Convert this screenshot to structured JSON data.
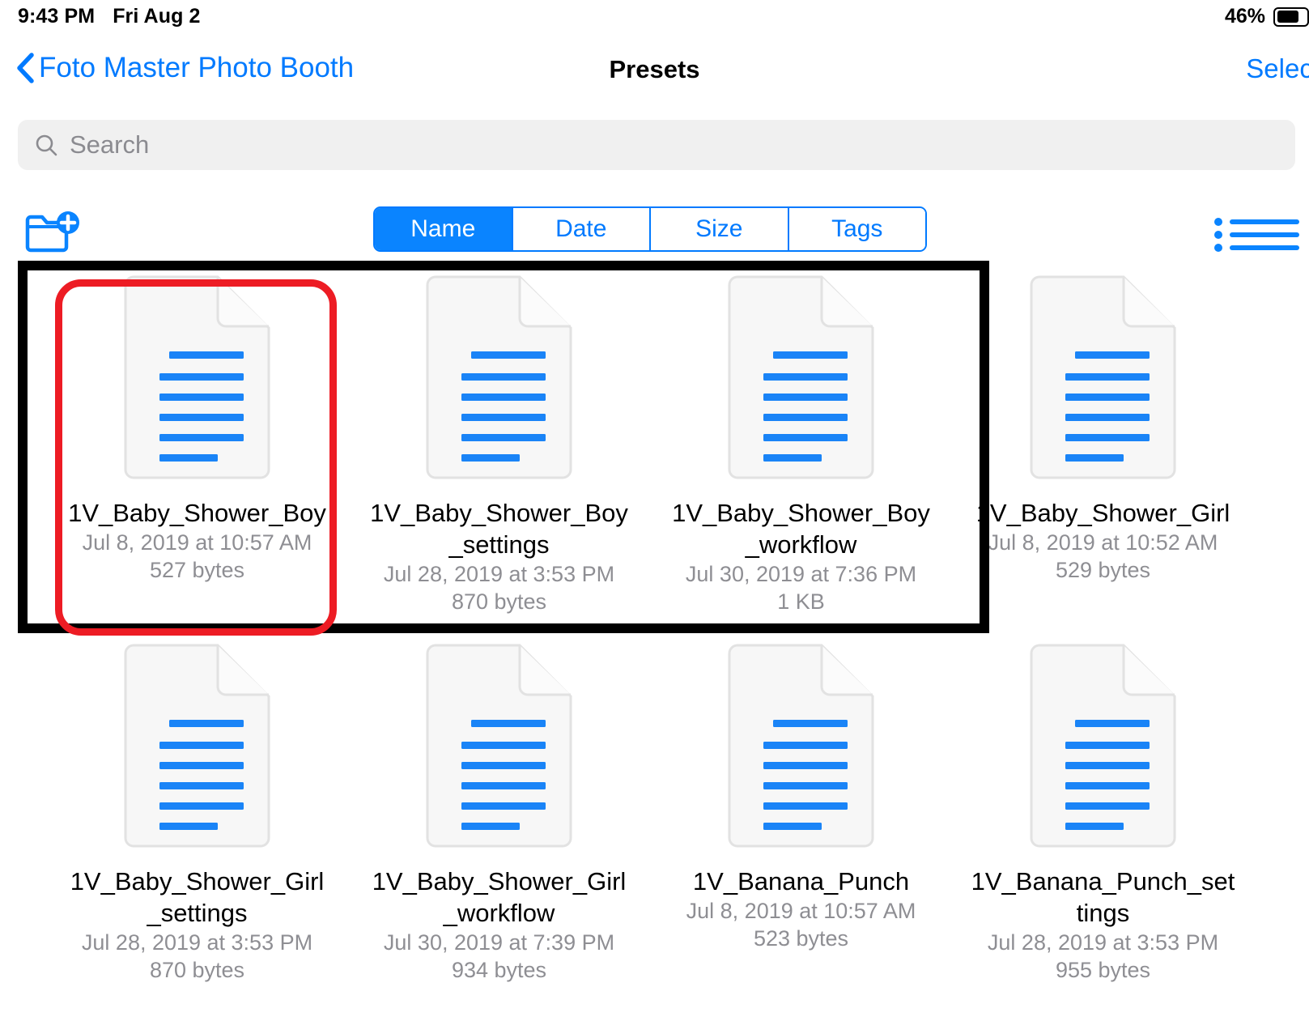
{
  "status_bar": {
    "time": "9:43 PM",
    "date": "Fri Aug 2",
    "battery_percent": "46%",
    "battery_icon": "battery-icon"
  },
  "nav": {
    "back_label": "Foto Master Photo Booth",
    "back_icon": "chevron-left-icon",
    "title": "Presets",
    "select_label": "Select"
  },
  "search": {
    "placeholder": "Search",
    "value": "",
    "icon": "search-icon"
  },
  "toolbar": {
    "new_folder_icon": "new-folder-icon",
    "list_view_icon": "list-view-icon",
    "sort_segments": [
      {
        "label": "Name",
        "selected": true
      },
      {
        "label": "Date",
        "selected": false
      },
      {
        "label": "Size",
        "selected": false
      },
      {
        "label": "Tags",
        "selected": false
      }
    ]
  },
  "colors": {
    "accent_blue": "#007AFF",
    "segment_blue": "#0A84FF",
    "doc_line_blue": "#1a84f7",
    "meta_gray": "#8e8e93",
    "search_bg": "#f0f0f0",
    "annotation_red": "#ED1C24",
    "annotation_black": "#000000"
  },
  "files": [
    {
      "name": "1V_Baby_Shower_Boy",
      "date": "Jul 8, 2019 at 10:57 AM",
      "size": "527 bytes",
      "icon": "document-icon"
    },
    {
      "name": "1V_Baby_Shower_Boy_settings",
      "date": "Jul 28, 2019 at 3:53 PM",
      "size": "870 bytes",
      "icon": "document-icon"
    },
    {
      "name": "1V_Baby_Shower_Boy_workflow",
      "date": "Jul 30, 2019 at 7:36 PM",
      "size": "1 KB",
      "icon": "document-icon"
    },
    {
      "name": "1V_Baby_Shower_Girl",
      "date": "Jul 8, 2019 at 10:52 AM",
      "size": "529 bytes",
      "icon": "document-icon"
    },
    {
      "name": "1V_Baby_Shower_Girl_settings",
      "date": "Jul 28, 2019 at 3:53 PM",
      "size": "870 bytes",
      "icon": "document-icon"
    },
    {
      "name": "1V_Baby_Shower_Girl_workflow",
      "date": "Jul 30, 2019 at 7:39 PM",
      "size": "934 bytes",
      "icon": "document-icon"
    },
    {
      "name": "1V_Banana_Punch",
      "date": "Jul 8, 2019 at 10:57 AM",
      "size": "523 bytes",
      "icon": "document-icon"
    },
    {
      "name": "1V_Banana_Punch_settings",
      "date": "Jul 28, 2019 at 3:53 PM",
      "size": "955 bytes",
      "icon": "document-icon"
    }
  ],
  "annotations": {
    "black_box_target": "first-row-of-files",
    "red_box_target": "1V_Baby_Shower_Boy"
  }
}
